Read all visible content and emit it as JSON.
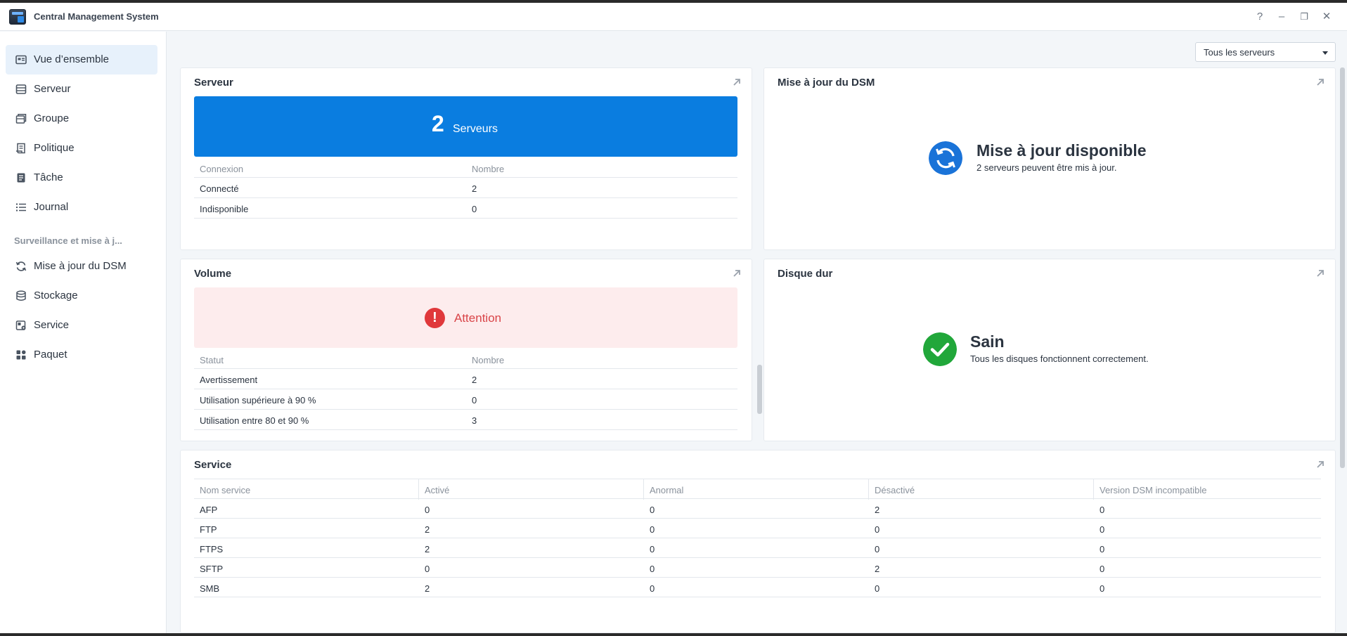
{
  "window": {
    "title": "Central Management System"
  },
  "titlebar": {
    "help": "?",
    "minimize": "–",
    "restore": "❐",
    "close": "✕"
  },
  "sidebar": {
    "items": [
      {
        "label": "Vue d’ensemble",
        "icon": "overview-icon",
        "active": true
      },
      {
        "label": "Serveur",
        "icon": "server-icon"
      },
      {
        "label": "Groupe",
        "icon": "group-icon"
      },
      {
        "label": "Politique",
        "icon": "policy-icon"
      },
      {
        "label": "Tâche",
        "icon": "task-icon"
      },
      {
        "label": "Journal",
        "icon": "log-icon"
      }
    ],
    "section_label": "Surveillance et mise à j...",
    "section_items": [
      {
        "label": "Mise à jour du DSM",
        "icon": "refresh-icon"
      },
      {
        "label": "Stockage",
        "icon": "database-icon"
      },
      {
        "label": "Service",
        "icon": "service-icon"
      },
      {
        "label": "Paquet",
        "icon": "package-icon"
      }
    ]
  },
  "filter": {
    "selected": "Tous les serveurs"
  },
  "server_card": {
    "title": "Serveur",
    "count": "2",
    "count_label": "Serveurs",
    "headers": [
      "Connexion",
      "Nombre"
    ],
    "rows": [
      [
        "Connecté",
        "2"
      ],
      [
        "Indisponible",
        "0"
      ]
    ]
  },
  "dsm_card": {
    "title": "Mise à jour du DSM",
    "status": "Mise à jour disponible",
    "detail": "2 serveurs peuvent être mis à jour."
  },
  "volume_card": {
    "title": "Volume",
    "status": "Attention",
    "headers": [
      "Statut",
      "Nombre"
    ],
    "rows": [
      [
        "Avertissement",
        "2"
      ],
      [
        "Utilisation supérieure à 90 %",
        "0"
      ],
      [
        "Utilisation entre 80 et 90 %",
        "3"
      ]
    ]
  },
  "disk_card": {
    "title": "Disque dur",
    "status": "Sain",
    "detail": "Tous les disques fonctionnent correctement."
  },
  "service_card": {
    "title": "Service",
    "headers": [
      "Nom service",
      "Activé",
      "Anormal",
      "Désactivé",
      "Version DSM incompatible"
    ],
    "rows": [
      [
        "AFP",
        "0",
        "0",
        "2",
        "0"
      ],
      [
        "FTP",
        "2",
        "0",
        "0",
        "0"
      ],
      [
        "FTPS",
        "2",
        "0",
        "0",
        "0"
      ],
      [
        "SFTP",
        "0",
        "0",
        "2",
        "0"
      ],
      [
        "SMB",
        "2",
        "0",
        "0",
        "0"
      ]
    ]
  },
  "colors": {
    "accent": "#0a7de0",
    "warning": "#e0383b",
    "success": "#21a73a",
    "update": "#1a73d8"
  }
}
